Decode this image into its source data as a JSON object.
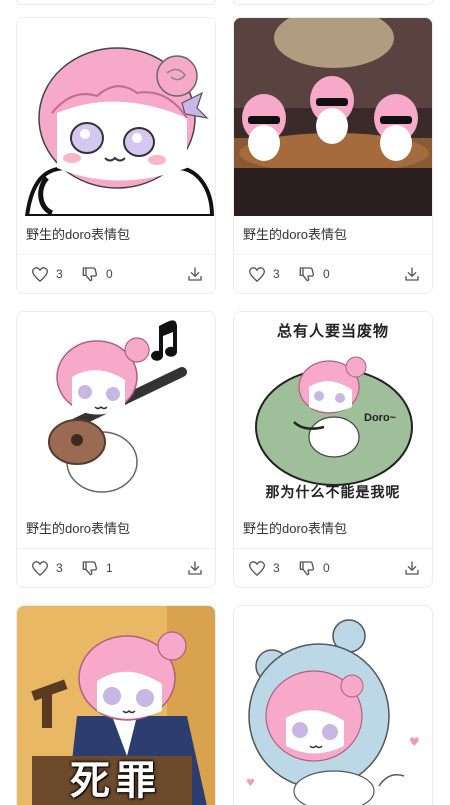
{
  "colors": {
    "accent_pink": "#f4a6c6",
    "text": "#333333",
    "icon": "#555555"
  },
  "cards": [
    {
      "title": "野生的doro表情包",
      "likes": "3",
      "dislikes": "0",
      "image": "doro-hug-meme"
    },
    {
      "title": "野生的doro表情包",
      "likes": "3",
      "dislikes": "0",
      "image": "doro-sunglasses-meme"
    },
    {
      "title": "野生的doro表情包",
      "likes": "3",
      "dislikes": "1",
      "image": "doro-guitar-meme"
    },
    {
      "title": "野生的doro表情包",
      "likes": "3",
      "dislikes": "0",
      "image": "doro-beanbag-meme",
      "caption_top": "总有人要当废物",
      "caption_label": "Doro~",
      "caption_bottom": "那为什么不能是我呢"
    },
    {
      "image": "doro-judge-meme",
      "caption": "死罪"
    },
    {
      "image": "doro-bear-costume-meme"
    }
  ],
  "icons": {
    "like": "heart-icon",
    "dislike": "thumbs-down-icon",
    "download": "download-icon"
  }
}
